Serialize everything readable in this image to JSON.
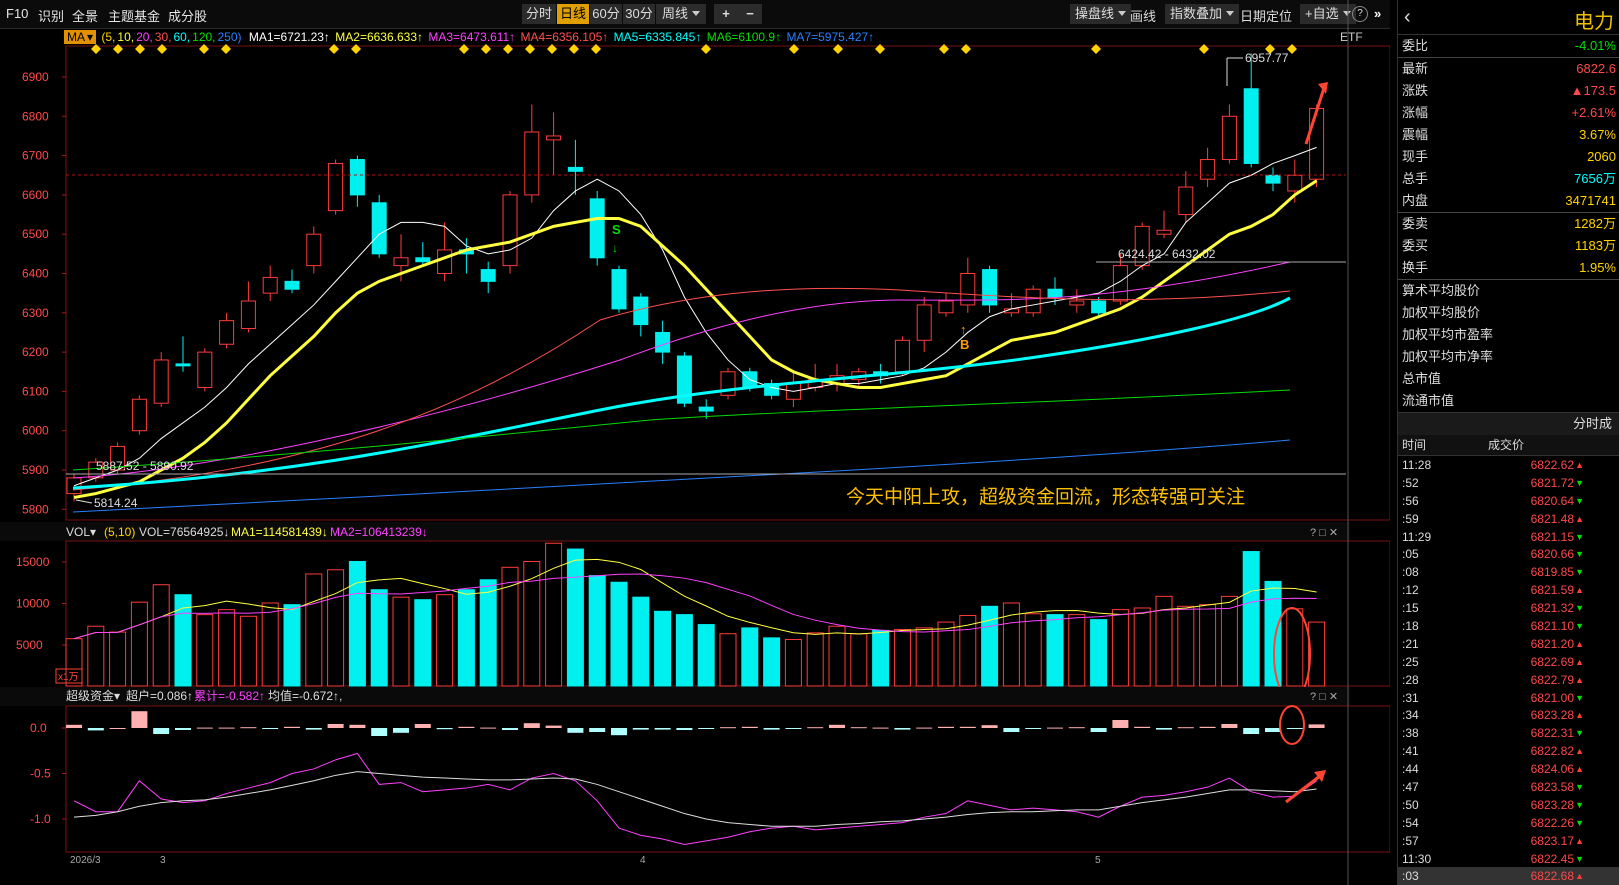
{
  "toolbar": {
    "left_items": [
      "F10",
      "识别",
      "全景",
      "主题基金",
      "成分股"
    ],
    "periods": [
      "分时",
      "日线",
      "60分",
      "30分",
      "周线"
    ],
    "active_period": "日线",
    "zoom_in": "+",
    "zoom_out": "−",
    "right_items": [
      "操盘线",
      "画线",
      "指数叠加",
      "日期定位",
      "+自选"
    ],
    "help": "?"
  },
  "ma_bar": {
    "selector": "MA",
    "params_prefix": "(5,",
    "p10": "10,",
    "p20": "20,",
    "p30": "30,",
    "p60": "60,",
    "p120": "120,",
    "p250": "250)",
    "ma1": "MA1=6721.23↑",
    "ma2": "MA2=6636.633↑",
    "ma3": "MA3=6473.611↑",
    "ma4": "MA4=6356.105↑",
    "ma5": "MA5=6335.845↑",
    "ma6": "MA6=6100.9↑",
    "ma7": "MA7=5975.427↑",
    "etf": "ETF"
  },
  "price_chart": {
    "y_ticks": [
      "6900",
      "6800",
      "6700",
      "6600",
      "6500",
      "6400",
      "6300",
      "6200",
      "6100",
      "6000",
      "5900",
      "5800"
    ],
    "high_label": "6957.77",
    "low_label": "5814.24",
    "range_low_label": "5887.52 - 5890.92",
    "range_high_label": "6424.42 - 6432.02",
    "annotation": "今天中阳上攻，超级资金回流，形态转强可关注",
    "marker_s": "S",
    "marker_b": "B"
  },
  "vol_panel": {
    "selector": "VOL",
    "params": "(5,10)",
    "vol": "VOL=76564925↓",
    "ma1": "MA1=114581439↓",
    "ma2": "MA2=106413239↓",
    "y_ticks": [
      "15000",
      "10000",
      "5000"
    ],
    "unit": "x1万",
    "controls": "? □ ✕"
  },
  "cap_panel": {
    "selector": "超级资金",
    "chaohu": "超户=0.086↑",
    "leiji": "累计=-0.582↑",
    "junzhi": "均值=-0.672↑,",
    "y_ticks": [
      "0.0",
      "-0.5",
      "-1.0"
    ],
    "controls": "? □ ✕"
  },
  "x_axis": {
    "labels": [
      "2026/3",
      "3",
      "4",
      "5"
    ]
  },
  "stock": {
    "name": "电力",
    "stats": [
      {
        "k": "委比",
        "v": "-4.01%",
        "c": "green"
      },
      {
        "k": "最新",
        "v": "6822.6",
        "c": "red"
      },
      {
        "k": "涨跌",
        "v": "▲173.5",
        "c": "red"
      },
      {
        "k": "涨幅",
        "v": "+2.61%",
        "c": "red"
      },
      {
        "k": "震幅",
        "v": "3.67%",
        "c": "yel"
      },
      {
        "k": "现手",
        "v": "2060",
        "c": "yel"
      },
      {
        "k": "总手",
        "v": "7656万",
        "c": "cyan"
      },
      {
        "k": "内盘",
        "v": "3471741",
        "c": "yel"
      },
      {
        "k": "委卖",
        "v": "1282万",
        "c": "yel"
      },
      {
        "k": "委买",
        "v": "1183万",
        "c": "yel"
      },
      {
        "k": "换手",
        "v": "1.95%",
        "c": "yel"
      }
    ],
    "extra": [
      "算术平均股价",
      "加权平均股价",
      "加权平均市盈率",
      "加权平均市净率",
      "总市值",
      "流通市值"
    ]
  },
  "trades": {
    "header": "分时成",
    "col_time": "时间",
    "col_price": "成交价",
    "rows": [
      {
        "t": "11:28",
        "p": "6822.62",
        "d": "up"
      },
      {
        "t": ":52",
        "p": "6821.72",
        "d": "down"
      },
      {
        "t": ":56",
        "p": "6820.64",
        "d": "down"
      },
      {
        "t": ":59",
        "p": "6821.48",
        "d": "up"
      },
      {
        "t": "11:29",
        "p": "6821.15",
        "d": "down"
      },
      {
        "t": ":05",
        "p": "6820.66",
        "d": "down"
      },
      {
        "t": ":08",
        "p": "6819.85",
        "d": "down"
      },
      {
        "t": ":12",
        "p": "6821.59",
        "d": "up"
      },
      {
        "t": ":15",
        "p": "6821.32",
        "d": "down"
      },
      {
        "t": ":18",
        "p": "6821.10",
        "d": "down"
      },
      {
        "t": ":21",
        "p": "6821.20",
        "d": "up"
      },
      {
        "t": ":25",
        "p": "6822.69",
        "d": "up"
      },
      {
        "t": ":28",
        "p": "6822.79",
        "d": "up"
      },
      {
        "t": ":31",
        "p": "6821.00",
        "d": "down"
      },
      {
        "t": ":34",
        "p": "6823.28",
        "d": "up"
      },
      {
        "t": ":38",
        "p": "6822.31",
        "d": "down"
      },
      {
        "t": ":41",
        "p": "6822.82",
        "d": "up"
      },
      {
        "t": ":44",
        "p": "6824.06",
        "d": "up"
      },
      {
        "t": ":47",
        "p": "6823.58",
        "d": "down"
      },
      {
        "t": ":50",
        "p": "6823.28",
        "d": "down"
      },
      {
        "t": ":54",
        "p": "6822.26",
        "d": "down"
      },
      {
        "t": ":57",
        "p": "6823.17",
        "d": "up"
      },
      {
        "t": "11:30",
        "p": "6822.45",
        "d": "down"
      },
      {
        "t": ":03",
        "p": "6822.68",
        "d": "up"
      }
    ]
  },
  "colors": {
    "up": "#ff3b3b",
    "down": "#00f0f0",
    "ma5": "#ffffff",
    "ma10": "#ffff40",
    "ma20": "#ff40ff",
    "ma30": "#ff5050",
    "ma60": "#00ffff",
    "ma120": "#00dd00",
    "ma250": "#2a7fff"
  },
  "chart_data": {
    "type": "candlestick",
    "y_unit": "index points",
    "candles": [
      [
        5840,
        5880,
        5820,
        5890
      ],
      [
        5880,
        5920,
        5870,
        5930
      ],
      [
        5900,
        5960,
        5890,
        5970
      ],
      [
        6000,
        6080,
        5990,
        6090
      ],
      [
        6070,
        6180,
        6060,
        6200
      ],
      [
        6170,
        6165,
        6150,
        6240
      ],
      [
        6110,
        6200,
        6100,
        6210
      ],
      [
        6220,
        6280,
        6210,
        6300
      ],
      [
        6260,
        6330,
        6250,
        6380
      ],
      [
        6350,
        6390,
        6330,
        6420
      ],
      [
        6380,
        6360,
        6350,
        6410
      ],
      [
        6420,
        6500,
        6400,
        6520
      ],
      [
        6560,
        6680,
        6550,
        6690
      ],
      [
        6690,
        6600,
        6570,
        6700
      ],
      [
        6580,
        6450,
        6440,
        6600
      ],
      [
        6420,
        6440,
        6380,
        6500
      ],
      [
        6440,
        6430,
        6420,
        6480
      ],
      [
        6400,
        6460,
        6380,
        6530
      ],
      [
        6460,
        6450,
        6400,
        6490
      ],
      [
        6410,
        6380,
        6350,
        6430
      ],
      [
        6420,
        6600,
        6400,
        6610
      ],
      [
        6600,
        6760,
        6580,
        6830
      ],
      [
        6740,
        6750,
        6650,
        6810
      ],
      [
        6670,
        6660,
        6600,
        6740
      ],
      [
        6590,
        6440,
        6420,
        6610
      ],
      [
        6410,
        6310,
        6300,
        6420
      ],
      [
        6340,
        6270,
        6240,
        6350
      ],
      [
        6250,
        6200,
        6170,
        6280
      ],
      [
        6190,
        6070,
        6060,
        6200
      ],
      [
        6060,
        6050,
        6030,
        6080
      ],
      [
        6090,
        6150,
        6080,
        6160
      ],
      [
        6150,
        6110,
        6100,
        6160
      ],
      [
        6120,
        6090,
        6080,
        6130
      ],
      [
        6080,
        6120,
        6060,
        6150
      ],
      [
        6110,
        6130,
        6100,
        6170
      ],
      [
        6120,
        6140,
        6100,
        6170
      ],
      [
        6130,
        6150,
        6110,
        6160
      ],
      [
        6150,
        6140,
        6120,
        6170
      ],
      [
        6150,
        6230,
        6140,
        6240
      ],
      [
        6230,
        6320,
        6200,
        6340
      ],
      [
        6300,
        6330,
        6290,
        6350
      ],
      [
        6320,
        6400,
        6300,
        6440
      ],
      [
        6410,
        6320,
        6300,
        6420
      ],
      [
        6300,
        6310,
        6290,
        6350
      ],
      [
        6300,
        6360,
        6290,
        6370
      ],
      [
        6360,
        6340,
        6320,
        6390
      ],
      [
        6320,
        6330,
        6300,
        6360
      ],
      [
        6330,
        6300,
        6290,
        6340
      ],
      [
        6330,
        6420,
        6320,
        6450
      ],
      [
        6420,
        6520,
        6410,
        6530
      ],
      [
        6500,
        6510,
        6490,
        6560
      ],
      [
        6550,
        6620,
        6530,
        6660
      ],
      [
        6640,
        6690,
        6620,
        6720
      ],
      [
        6690,
        6800,
        6680,
        6830
      ],
      [
        6870,
        6680,
        6670,
        6960
      ],
      [
        6650,
        6630,
        6610,
        6670
      ],
      [
        6610,
        6650,
        6580,
        6690
      ],
      [
        6640,
        6820,
        6620,
        6830
      ]
    ],
    "ma5": [
      5860,
      5880,
      5900,
      5930,
      5980,
      6020,
      6060,
      6110,
      6170,
      6220,
      6270,
      6320,
      6380,
      6440,
      6500,
      6530,
      6530,
      6520,
      6470,
      6450,
      6460,
      6490,
      6560,
      6610,
      6640,
      6610,
      6550,
      6460,
      6340,
      6250,
      6180,
      6130,
      6110,
      6100,
      6110,
      6120,
      6120,
      6130,
      6140,
      6160,
      6200,
      6250,
      6290,
      6310,
      6320,
      6330,
      6340,
      6350,
      6380,
      6420,
      6450,
      6530,
      6580,
      6630,
      6650,
      6680,
      6700,
      6721
    ],
    "ma10": [
      5830,
      5840,
      5855,
      5870,
      5900,
      5930,
      5970,
      6020,
      6080,
      6140,
      6190,
      6240,
      6300,
      6350,
      6380,
      6400,
      6420,
      6440,
      6460,
      6470,
      6480,
      6500,
      6520,
      6530,
      6540,
      6540,
      6520,
      6470,
      6420,
      6360,
      6300,
      6240,
      6180,
      6150,
      6130,
      6120,
      6110,
      6110,
      6120,
      6130,
      6140,
      6170,
      6200,
      6230,
      6240,
      6250,
      6270,
      6290,
      6310,
      6340,
      6380,
      6420,
      6460,
      6500,
      6520,
      6550,
      6600,
      6636
    ]
  }
}
